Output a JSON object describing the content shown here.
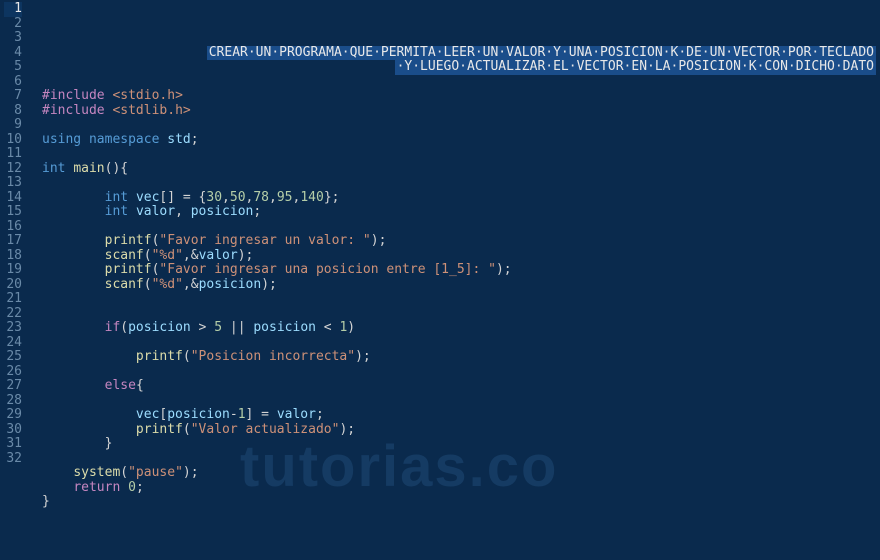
{
  "watermark": "tutorias.co",
  "active_line": 1,
  "lines": [
    {
      "n": 1,
      "type": "comment-right",
      "text": "CREAR·UN·PROGRAMA·QUE·PERMITA·LEER·UN·VALOR·Y·UNA·POSICION·K·DE·UN·VECTOR·POR·TECLADO"
    },
    {
      "n": 2,
      "type": "comment-right",
      "text": "·Y·LUEGO·ACTUALIZAR·EL·VECTOR·EN·LA·POSICION·K·CON·DICHO·DATO"
    },
    {
      "n": 3,
      "type": "blank"
    },
    {
      "n": 4,
      "type": "code",
      "tokens": [
        {
          "c": "k-pre",
          "t": "#include"
        },
        {
          "c": "plain",
          "t": " "
        },
        {
          "c": "k-inc",
          "t": "<stdio.h>"
        }
      ]
    },
    {
      "n": 5,
      "type": "code",
      "tokens": [
        {
          "c": "k-pre",
          "t": "#include"
        },
        {
          "c": "plain",
          "t": " "
        },
        {
          "c": "k-inc",
          "t": "<stdlib.h>"
        }
      ]
    },
    {
      "n": 6,
      "type": "blank"
    },
    {
      "n": 7,
      "type": "code",
      "tokens": [
        {
          "c": "k-type",
          "t": "using"
        },
        {
          "c": "plain",
          "t": " "
        },
        {
          "c": "k-type",
          "t": "namespace"
        },
        {
          "c": "plain",
          "t": " "
        },
        {
          "c": "id",
          "t": "std"
        },
        {
          "c": "pun",
          "t": ";"
        }
      ]
    },
    {
      "n": 8,
      "type": "blank"
    },
    {
      "n": 9,
      "type": "code",
      "tokens": [
        {
          "c": "k-type",
          "t": "int"
        },
        {
          "c": "plain",
          "t": " "
        },
        {
          "c": "fn",
          "t": "main"
        },
        {
          "c": "pun",
          "t": "(){"
        }
      ]
    },
    {
      "n": 10,
      "type": "blank"
    },
    {
      "n": 11,
      "type": "code",
      "indent": 8,
      "tokens": [
        {
          "c": "k-type",
          "t": "int"
        },
        {
          "c": "plain",
          "t": " "
        },
        {
          "c": "id",
          "t": "vec"
        },
        {
          "c": "pun",
          "t": "[] = {"
        },
        {
          "c": "num",
          "t": "30"
        },
        {
          "c": "pun",
          "t": ","
        },
        {
          "c": "num",
          "t": "50"
        },
        {
          "c": "pun",
          "t": ","
        },
        {
          "c": "num",
          "t": "78"
        },
        {
          "c": "pun",
          "t": ","
        },
        {
          "c": "num",
          "t": "95"
        },
        {
          "c": "pun",
          "t": ","
        },
        {
          "c": "num",
          "t": "140"
        },
        {
          "c": "pun",
          "t": "};"
        }
      ]
    },
    {
      "n": 12,
      "type": "code",
      "indent": 8,
      "tokens": [
        {
          "c": "k-type",
          "t": "int"
        },
        {
          "c": "plain",
          "t": " "
        },
        {
          "c": "id",
          "t": "valor"
        },
        {
          "c": "pun",
          "t": ", "
        },
        {
          "c": "id",
          "t": "posicion"
        },
        {
          "c": "pun",
          "t": ";"
        }
      ]
    },
    {
      "n": 13,
      "type": "blank"
    },
    {
      "n": 14,
      "type": "code",
      "indent": 8,
      "tokens": [
        {
          "c": "fn",
          "t": "printf"
        },
        {
          "c": "pun",
          "t": "("
        },
        {
          "c": "str",
          "t": "\"Favor ingresar un valor: \""
        },
        {
          "c": "pun",
          "t": ");"
        }
      ]
    },
    {
      "n": 15,
      "type": "code",
      "indent": 8,
      "tokens": [
        {
          "c": "fn",
          "t": "scanf"
        },
        {
          "c": "pun",
          "t": "("
        },
        {
          "c": "str",
          "t": "\"%d\""
        },
        {
          "c": "pun",
          "t": ",&"
        },
        {
          "c": "id",
          "t": "valor"
        },
        {
          "c": "pun",
          "t": ");"
        }
      ]
    },
    {
      "n": 16,
      "type": "code",
      "indent": 8,
      "tokens": [
        {
          "c": "fn",
          "t": "printf"
        },
        {
          "c": "pun",
          "t": "("
        },
        {
          "c": "str",
          "t": "\"Favor ingresar una posicion entre [1_5]: \""
        },
        {
          "c": "pun",
          "t": ");"
        }
      ]
    },
    {
      "n": 17,
      "type": "code",
      "indent": 8,
      "tokens": [
        {
          "c": "fn",
          "t": "scanf"
        },
        {
          "c": "pun",
          "t": "("
        },
        {
          "c": "str",
          "t": "\"%d\""
        },
        {
          "c": "pun",
          "t": ",&"
        },
        {
          "c": "id",
          "t": "posicion"
        },
        {
          "c": "pun",
          "t": ");"
        }
      ]
    },
    {
      "n": 18,
      "type": "blank"
    },
    {
      "n": 19,
      "type": "blank"
    },
    {
      "n": 20,
      "type": "code",
      "indent": 8,
      "tokens": [
        {
          "c": "kw",
          "t": "if"
        },
        {
          "c": "pun",
          "t": "("
        },
        {
          "c": "id",
          "t": "posicion"
        },
        {
          "c": "plain",
          "t": " > "
        },
        {
          "c": "num",
          "t": "5"
        },
        {
          "c": "plain",
          "t": " || "
        },
        {
          "c": "id",
          "t": "posicion"
        },
        {
          "c": "plain",
          "t": " < "
        },
        {
          "c": "num",
          "t": "1"
        },
        {
          "c": "pun",
          "t": ")"
        }
      ]
    },
    {
      "n": 21,
      "type": "blank"
    },
    {
      "n": 22,
      "type": "code",
      "indent": 12,
      "tokens": [
        {
          "c": "fn",
          "t": "printf"
        },
        {
          "c": "pun",
          "t": "("
        },
        {
          "c": "str",
          "t": "\"Posicion incorrecta\""
        },
        {
          "c": "pun",
          "t": ");"
        }
      ]
    },
    {
      "n": 23,
      "type": "blank"
    },
    {
      "n": 24,
      "type": "code",
      "indent": 8,
      "tokens": [
        {
          "c": "kw",
          "t": "else"
        },
        {
          "c": "pun",
          "t": "{"
        }
      ]
    },
    {
      "n": 25,
      "type": "blank"
    },
    {
      "n": 26,
      "type": "code",
      "indent": 12,
      "tokens": [
        {
          "c": "id",
          "t": "vec"
        },
        {
          "c": "pun",
          "t": "["
        },
        {
          "c": "id",
          "t": "posicion"
        },
        {
          "c": "pun",
          "t": "-"
        },
        {
          "c": "num",
          "t": "1"
        },
        {
          "c": "pun",
          "t": "] = "
        },
        {
          "c": "id",
          "t": "valor"
        },
        {
          "c": "pun",
          "t": ";"
        }
      ]
    },
    {
      "n": 27,
      "type": "code",
      "indent": 12,
      "tokens": [
        {
          "c": "fn",
          "t": "printf"
        },
        {
          "c": "pun",
          "t": "("
        },
        {
          "c": "str",
          "t": "\"Valor actualizado\""
        },
        {
          "c": "pun",
          "t": ");"
        }
      ]
    },
    {
      "n": 28,
      "type": "code",
      "indent": 8,
      "tokens": [
        {
          "c": "pun",
          "t": "}"
        }
      ]
    },
    {
      "n": 29,
      "type": "blank"
    },
    {
      "n": 30,
      "type": "code",
      "indent": 4,
      "tokens": [
        {
          "c": "fn",
          "t": "system"
        },
        {
          "c": "pun",
          "t": "("
        },
        {
          "c": "str",
          "t": "\"pause\""
        },
        {
          "c": "pun",
          "t": ");"
        }
      ]
    },
    {
      "n": 31,
      "type": "code",
      "indent": 4,
      "tokens": [
        {
          "c": "kw",
          "t": "return"
        },
        {
          "c": "plain",
          "t": " "
        },
        {
          "c": "num",
          "t": "0"
        },
        {
          "c": "pun",
          "t": ";"
        }
      ]
    },
    {
      "n": 32,
      "type": "code",
      "tokens": [
        {
          "c": "pun",
          "t": "}"
        }
      ]
    }
  ]
}
